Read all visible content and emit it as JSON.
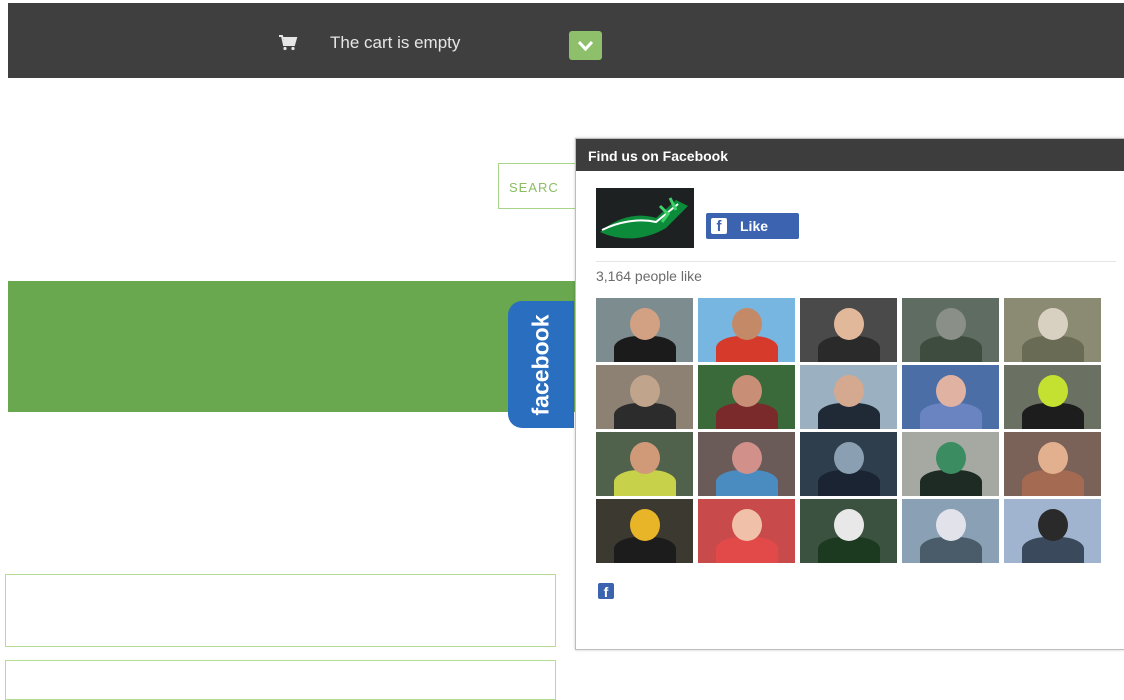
{
  "header": {
    "cart_text": "The cart is empty",
    "colors": {
      "bar": "#3f3f3f",
      "toggle": "#8ec06c"
    }
  },
  "search": {
    "label": "SEARC"
  },
  "facebook_tab": {
    "label": "facebook",
    "color": "#2a6ec0"
  },
  "fb_widget": {
    "title": "Find us on Facebook",
    "like_button_label": "Like",
    "like_count_text": "3,164 people like",
    "f_glyph": "f",
    "faces": [
      {
        "bg": "#7d8c8f",
        "skin": "#d2a082",
        "shirt": "#1b1b1b"
      },
      {
        "bg": "#76b6e0",
        "skin": "#c48a68",
        "shirt": "#d63a2a"
      },
      {
        "bg": "#4a4a4a",
        "skin": "#e2b89a",
        "shirt": "#2a2a2a"
      },
      {
        "bg": "#5f6c62",
        "skin": "#8a8f88",
        "shirt": "#3d4c3f"
      },
      {
        "bg": "#8b8a72",
        "skin": "#d8d0c0",
        "shirt": "#6a6b54"
      },
      {
        "bg": "#8d8173",
        "skin": "#c0a48c",
        "shirt": "#2c2c2c"
      },
      {
        "bg": "#3a6a3a",
        "skin": "#c98e76",
        "shirt": "#7a2a2a"
      },
      {
        "bg": "#9bb0c0",
        "skin": "#d5a890",
        "shirt": "#1f2a36"
      },
      {
        "bg": "#4c6ea6",
        "skin": "#e0b2a2",
        "shirt": "#6a84c2"
      },
      {
        "bg": "#6a7062",
        "skin": "#c4e030",
        "shirt": "#1d1d1d"
      },
      {
        "bg": "#50624c",
        "skin": "#d09a78",
        "shirt": "#c7d14a"
      },
      {
        "bg": "#6a5a58",
        "skin": "#d2908a",
        "shirt": "#4a8cc0"
      },
      {
        "bg": "#2e3e4c",
        "skin": "#8aa0b2",
        "shirt": "#1a2432"
      },
      {
        "bg": "#a6a8a2",
        "skin": "#3c8c62",
        "shirt": "#1d2b24"
      },
      {
        "bg": "#7a6258",
        "skin": "#e2b08e",
        "shirt": "#a46a52"
      },
      {
        "bg": "#3c3a30",
        "skin": "#e8b428",
        "shirt": "#1c1c1c"
      },
      {
        "bg": "#c84a4a",
        "skin": "#f0c0a8",
        "shirt": "#e24a4a"
      },
      {
        "bg": "#3c5240",
        "skin": "#e8e8e8",
        "shirt": "#1c3a20"
      },
      {
        "bg": "#8aa0b4",
        "skin": "#e2e2ea",
        "shirt": "#4a5c6a"
      },
      {
        "bg": "#a0b4d0",
        "skin": "#2a2a2a",
        "shirt": "#3a4a5c"
      }
    ]
  }
}
